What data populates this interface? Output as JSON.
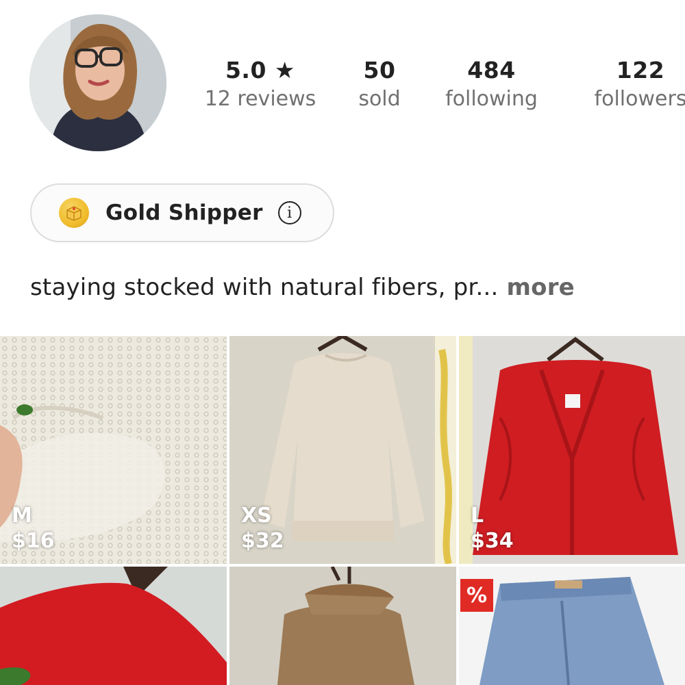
{
  "profile": {
    "stats": [
      {
        "id": "reviews",
        "value": "5.0 ★",
        "label": "12 reviews"
      },
      {
        "id": "sold",
        "value": "50",
        "label": "sold"
      },
      {
        "id": "following",
        "value": "484",
        "label": "following"
      },
      {
        "id": "followers",
        "value": "122",
        "label": "followers"
      }
    ],
    "badge": {
      "label": "Gold Shipper",
      "icon": "gold-box-icon",
      "info_icon": "info-icon",
      "info_glyph": "i"
    },
    "bio": {
      "text": "staying stocked with natural fibers, pr...",
      "more": " more"
    }
  },
  "listings": [
    {
      "size": "M",
      "price": "$16"
    },
    {
      "size": "XS",
      "price": "$32"
    },
    {
      "size": "L",
      "price": "$34"
    },
    {
      "size": "",
      "price": ""
    },
    {
      "size": "",
      "price": ""
    },
    {
      "size": "",
      "price": "",
      "discount": "%"
    }
  ],
  "colors": {
    "accent": "#e02b24",
    "gold": "#f0bd2c",
    "muted_text": "#707070"
  }
}
